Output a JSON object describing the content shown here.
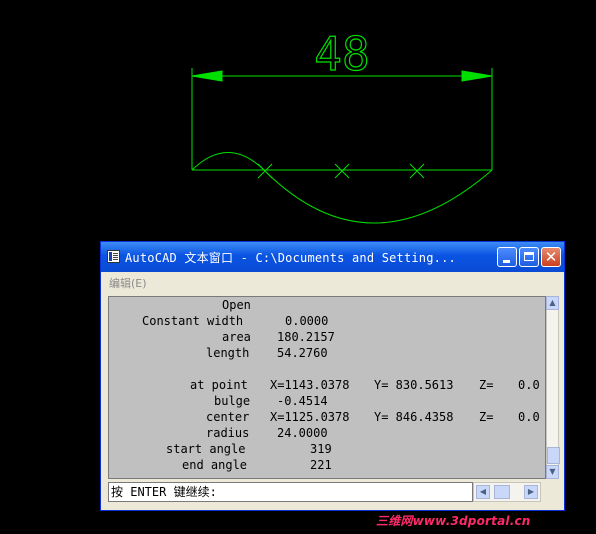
{
  "drawing": {
    "dimension_text": "48",
    "color": "#00e000"
  },
  "window": {
    "title": "AutoCAD 文本窗口 - C:\\Documents and Setting...",
    "menu": {
      "edit_label": "编辑(E)"
    },
    "buttons": {
      "minimize_icon": "minimize-icon",
      "maximize_icon": "maximize-icon",
      "close_icon": "close-icon"
    }
  },
  "output": {
    "lines": [
      {
        "label": "Open",
        "value": ""
      },
      {
        "label": "Constant width",
        "value": "0.0000"
      },
      {
        "label": "area",
        "value": "180.2157"
      },
      {
        "label": "length",
        "value": "54.2760"
      },
      {
        "label": "",
        "value": ""
      },
      {
        "label": "at point",
        "x": "X=1143.0378",
        "y": "Y= 830.5613",
        "z": "Z=",
        "zval": "0.0"
      },
      {
        "label": "bulge",
        "value": "-0.4514"
      },
      {
        "label": "center",
        "x": "X=1125.0378",
        "y": "Y= 846.4358",
        "z": "Z=",
        "zval": "0.0"
      },
      {
        "label": "radius",
        "value": "24.0000"
      },
      {
        "label": "start angle",
        "value": "319"
      },
      {
        "label": "end angle",
        "value": "221"
      }
    ]
  },
  "command_line": {
    "prompt": "按 ENTER 键继续:"
  },
  "watermark": {
    "text": "三维网www.3dportal.cn"
  }
}
